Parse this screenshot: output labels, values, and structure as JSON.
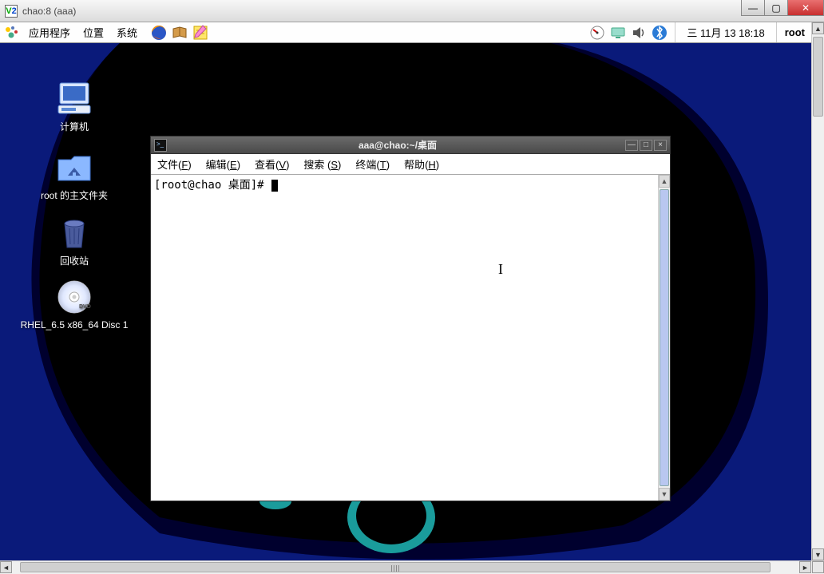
{
  "outer_window": {
    "title": "chao:8 (aaa)",
    "controls": {
      "minimize": "—",
      "maximize": "▢",
      "close": "✕"
    }
  },
  "linux_panel": {
    "menus": {
      "apps": "应用程序",
      "places": "位置",
      "system": "系统"
    },
    "clock": "三 11月 13 18:18",
    "user": "root"
  },
  "desktop_icons": {
    "computer": "计算机",
    "home": "root 的主文件夹",
    "trash": "回收站",
    "dvd": "RHEL_6.5 x86_64 Disc 1"
  },
  "terminal": {
    "title": "aaa@chao:~/桌面",
    "controls": {
      "minimize": "—",
      "maximize": "□",
      "close": "×"
    },
    "menus": {
      "file": {
        "label": "文件",
        "acc": "F"
      },
      "edit": {
        "label": "编辑",
        "acc": "E"
      },
      "view": {
        "label": "查看",
        "acc": "V"
      },
      "search": {
        "label": "搜索 ",
        "acc": "S"
      },
      "term": {
        "label": "终端",
        "acc": "T"
      },
      "help": {
        "label": "帮助",
        "acc": "H"
      }
    },
    "prompt": "[root@chao 桌面]# "
  }
}
